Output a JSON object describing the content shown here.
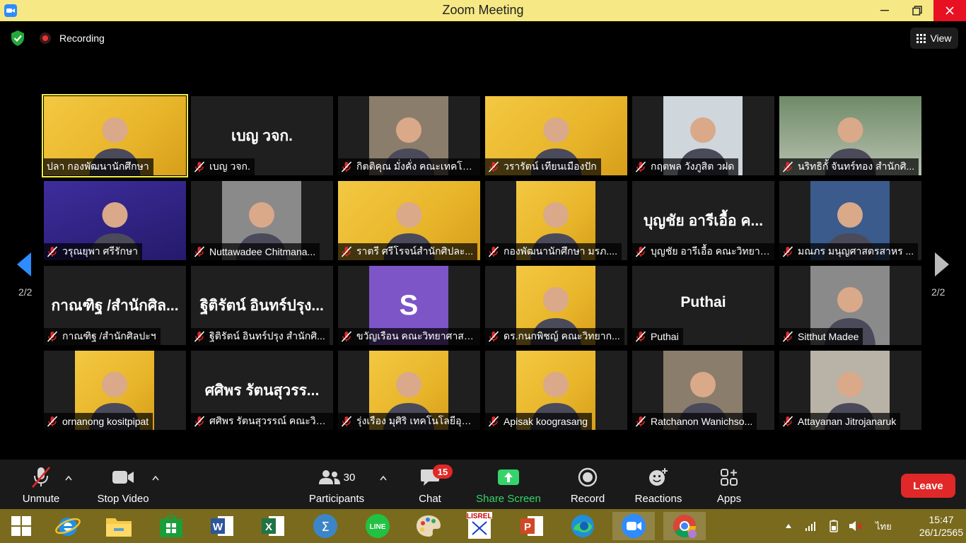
{
  "window": {
    "title": "Zoom Meeting"
  },
  "meeting_bar": {
    "recording_label": "Recording",
    "view_label": "View"
  },
  "gallery": {
    "page_indicator_left": "2/2",
    "page_indicator_right": "2/2",
    "tiles": [
      {
        "name": "ปลา กองพัฒนานักศึกษา",
        "muted": false,
        "video": true,
        "active": true
      },
      {
        "name": "เบญ วจก.",
        "big_name": "เบญ วจก.",
        "muted": true,
        "video": false
      },
      {
        "name": "กิตติคุณ มั่งคั่ง คณะเทคโนโ...",
        "muted": true,
        "video": true
      },
      {
        "name": "วรารัตน์ เทียนเมืองปัก",
        "muted": true,
        "video": true
      },
      {
        "name": "กฤตพล วังภูสิต วฝด",
        "muted": true,
        "video": true
      },
      {
        "name": "นริทธิกั้ จันทร์ทอง สำนักศิ...",
        "muted": true,
        "video": true
      },
      {
        "name": "วรุณยุพา ศรีรักษา",
        "muted": true,
        "video": true
      },
      {
        "name": "Nuttawadee Chitmana...",
        "muted": true,
        "video": true
      },
      {
        "name": "ราตรี ศรีโรจน์สำนักศิปละ...",
        "muted": true,
        "video": true
      },
      {
        "name": "กองพัฒนานักศึกษา มรภ....",
        "muted": true,
        "video": true
      },
      {
        "name": "บุญชัย อารีเอื้อ คณะวิทยาศ...",
        "big_name": "บุญชัย อารีเอื้อ ค...",
        "muted": true,
        "video": false
      },
      {
        "name": "มณภร มนุญศาสตรสาหร ...",
        "muted": true,
        "video": true
      },
      {
        "name": "กาณฑิฐ /สำนักศิลปะฯ",
        "big_name": "กาณฑิฐ /สำนักศิล...",
        "muted": true,
        "video": false
      },
      {
        "name": "ฐิติรัตน์ อินทร์ปรุง สำนักศิ...",
        "big_name": "ฐิติรัตน์ อินทร์ปรุง...",
        "muted": true,
        "video": false
      },
      {
        "name": "ขวัญเรือน คณะวิทยาศาสต...",
        "avatar_letter": "S",
        "muted": true,
        "video": false
      },
      {
        "name": "ดร.กนกพิชญ์ คณะวิทยาก...",
        "muted": true,
        "video": true
      },
      {
        "name": "Puthai",
        "big_name": "Puthai",
        "muted": true,
        "video": false
      },
      {
        "name": "Sitthut Madee",
        "muted": true,
        "video": true
      },
      {
        "name": "ornanong kositpipat",
        "muted": true,
        "video": true
      },
      {
        "name": "ศศิพร รัตนสุวรรณ์ คณะวิท...",
        "big_name": "ศศิพร รัตนสุวรร...",
        "muted": true,
        "video": false
      },
      {
        "name": "รุ่งเรือง มุศิริ เทคโนโลยีอุตส...",
        "muted": true,
        "video": true
      },
      {
        "name": "Apisak koograsang",
        "muted": true,
        "video": true
      },
      {
        "name": "Ratchanon Wanichso...",
        "muted": true,
        "video": true
      },
      {
        "name": "Attayanan Jitrojanaruk",
        "muted": true,
        "video": true
      }
    ]
  },
  "toolbar": {
    "unmute_label": "Unmute",
    "stop_video_label": "Stop Video",
    "participants_label": "Participants",
    "participants_count": "30",
    "chat_label": "Chat",
    "chat_badge": "15",
    "share_screen_label": "Share Screen",
    "record_label": "Record",
    "reactions_label": "Reactions",
    "apps_label": "Apps",
    "leave_label": "Leave"
  },
  "taskbar": {
    "language": "ไทย",
    "time": "15:47",
    "date": "26/1/2565",
    "lisrel_label": "LISREL"
  },
  "colors": {
    "titlebar": "#f6e884",
    "active_speaker": "#f5ee45",
    "share_screen": "#35d36b",
    "leave": "#e02828",
    "taskbar": "#7a6a1d"
  }
}
